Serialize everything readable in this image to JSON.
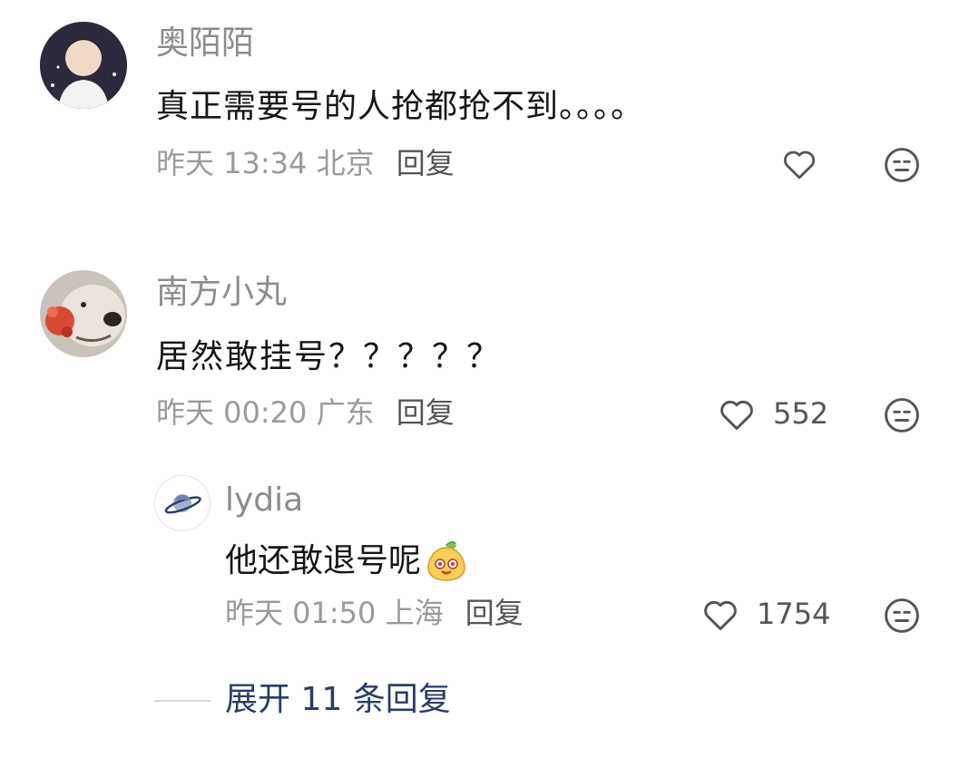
{
  "comments": [
    {
      "name": "奥陌陌",
      "text": "真正需要号的人抢都抢不到。。。。",
      "time": "昨天 13:34",
      "location": "北京",
      "reply_label": "回复",
      "likes": ""
    },
    {
      "name": "南方小丸",
      "text": "居然敢挂号？？？？？",
      "time": "昨天 00:20",
      "location": "广东",
      "reply_label": "回复",
      "likes": "552"
    }
  ],
  "reply": {
    "name": "lydia",
    "text": "他还敢退号呢",
    "time": "昨天 01:50",
    "location": "上海",
    "reply_label": "回复",
    "likes": "1754"
  },
  "expand": {
    "label": "展开 11 条回复"
  },
  "colors": {
    "link": "#2a3d66",
    "meta": "#9a9a9a",
    "icon": "#555555"
  },
  "icons": {
    "like": "heart-outline-icon",
    "dislike": "meh-face-icon",
    "emoji": "pear-emoji-icon",
    "avatar_reply": "planet-icon"
  }
}
